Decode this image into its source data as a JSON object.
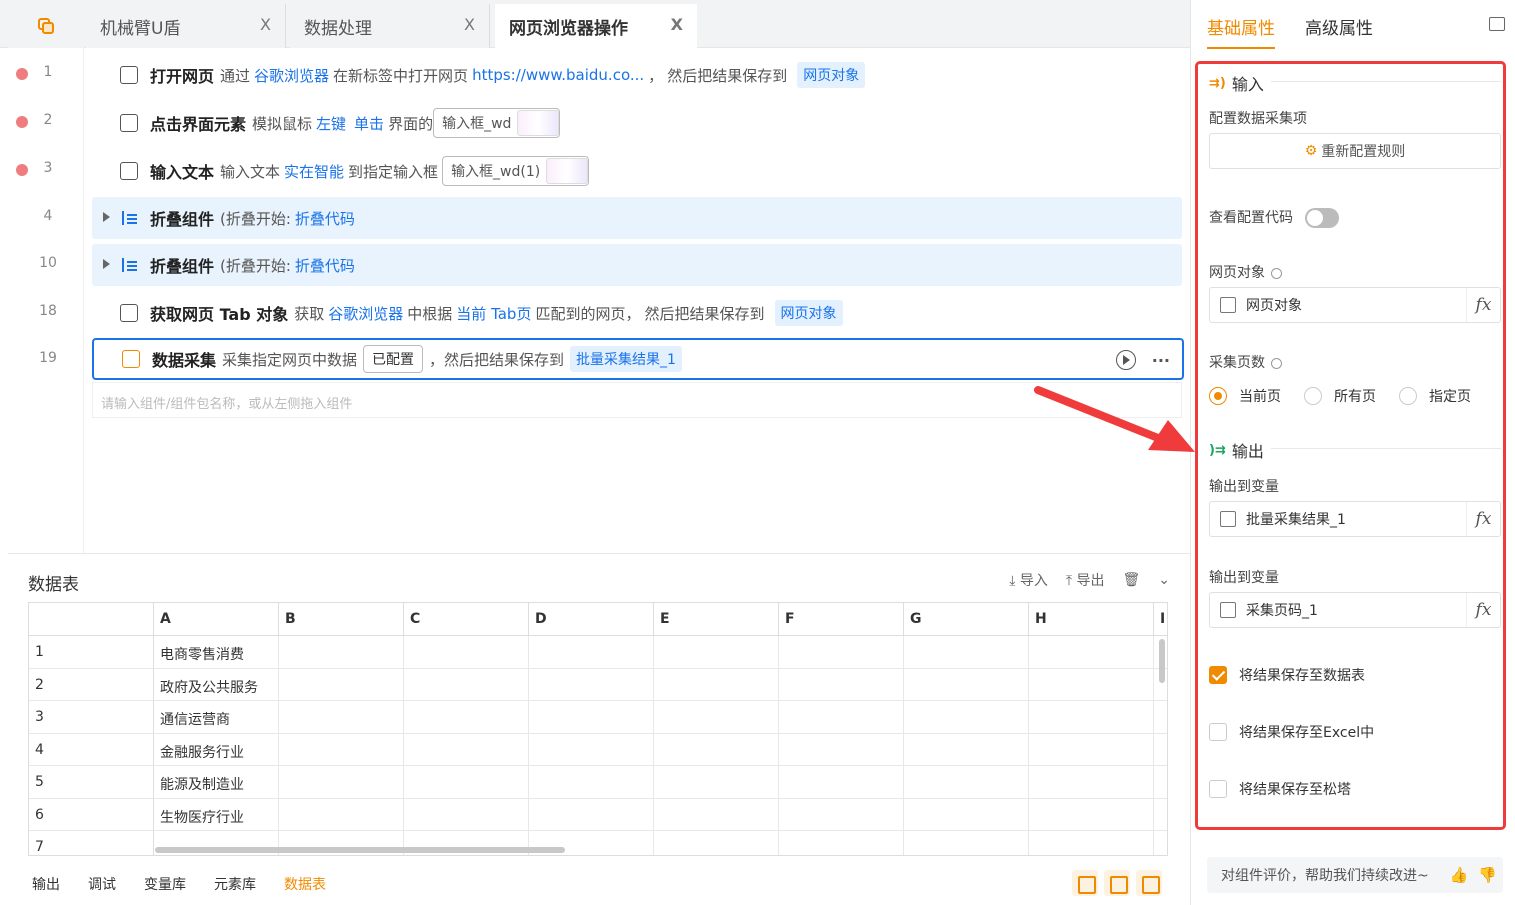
{
  "tabs": [
    {
      "label": "机械臂U盾"
    },
    {
      "label": "数据处理"
    },
    {
      "label": "网页浏览器操作"
    }
  ],
  "tab_close": "X",
  "flow": {
    "lines": [
      {
        "n": "1"
      },
      {
        "n": "2"
      },
      {
        "n": "3"
      },
      {
        "n": "4"
      },
      {
        "n": "10"
      },
      {
        "n": "18"
      },
      {
        "n": "19"
      }
    ],
    "row1": {
      "title": "打开网页",
      "t1": "通过",
      "browser": "谷歌浏览器",
      "t2": "在新标签中打开网页",
      "url": "https://www.baidu.co...",
      "t3": "，",
      "t4": "然后把结果保存到",
      "var": "网页对象"
    },
    "row2": {
      "title": "点击界面元素",
      "t1": "模拟鼠标",
      "btn": "左键",
      "act": "单击",
      "t2": "界面的",
      "elem": "输入框_wd"
    },
    "row3": {
      "title": "输入文本",
      "t1": "输入文本",
      "text": "实在智能",
      "t2": "到指定输入框",
      "elem": "输入框_wd(1)"
    },
    "row4": {
      "title": "折叠组件",
      "t1": "(折叠开始:",
      "name": "折叠代码"
    },
    "row10": {
      "title": "折叠组件",
      "t1": "(折叠开始:",
      "name": "折叠代码"
    },
    "row18": {
      "title": "获取网页 Tab 对象",
      "t1": "获取",
      "browser": "谷歌浏览器",
      "t2": "中根据",
      "tab": "当前 Tab页",
      "t3": "匹配到的网页，",
      "t4": "然后把结果保存到",
      "var": "网页对象"
    },
    "row19": {
      "title": "数据采集",
      "t1": "采集指定网页中数据",
      "cfg": "已配置",
      "t2": "，然后把结果保存到",
      "var": "批量采集结果_1",
      "more": "···"
    },
    "add_placeholder": "请输入组件/组件包名称，或从左侧拖入组件"
  },
  "datatable": {
    "title": "数据表",
    "import": "导入",
    "export": "导出",
    "columns": [
      "A",
      "B",
      "C",
      "D",
      "E",
      "F",
      "G",
      "H",
      "I"
    ],
    "rows": [
      {
        "i": "1",
        "a": "电商零售消费"
      },
      {
        "i": "2",
        "a": "政府及公共服务"
      },
      {
        "i": "3",
        "a": "通信运营商"
      },
      {
        "i": "4",
        "a": "金融服务行业"
      },
      {
        "i": "5",
        "a": "能源及制造业"
      },
      {
        "i": "6",
        "a": "生物医疗行业"
      },
      {
        "i": "7",
        "a": ""
      }
    ],
    "bottom_tabs": [
      "输出",
      "调试",
      "变量库",
      "元素库",
      "数据表"
    ],
    "active_bottom_tab": "数据表"
  },
  "panel": {
    "tabs": [
      "基础属性",
      "高级属性"
    ],
    "input_section": "输入",
    "config_label": "配置数据采集项",
    "reconfig": "重新配置规则",
    "view_code": "查看配置代码",
    "web_obj_label": "网页对象",
    "web_obj_value": "网页对象",
    "pages_label": "采集页数",
    "radio": [
      "当前页",
      "所有页",
      "指定页"
    ],
    "output_section": "输出",
    "out1_label": "输出到变量",
    "out1_value": "批量采集结果_1",
    "out2_label": "输出到变量",
    "out2_value": "采集页码_1",
    "chk1": "将结果保存至数据表",
    "chk2": "将结果保存至Excel中",
    "chk3": "将结果保存至松塔",
    "fx": "fx",
    "feedback": "对组件评价，帮助我们持续改进~"
  },
  "colors": {
    "accent": "#f08a00",
    "link": "#1a73e8",
    "highlight": "#ef3b3b"
  }
}
